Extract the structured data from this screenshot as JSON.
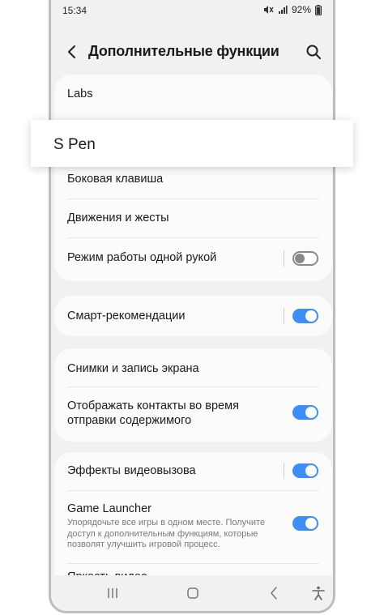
{
  "status": {
    "time": "15:34",
    "battery": "92%"
  },
  "header": {
    "title": "Дополнительные функции"
  },
  "items": {
    "labs": "Labs",
    "side_key": "Боковая клавиша",
    "motions": "Движения и жесты",
    "one_hand": "Режим работы одной рукой",
    "smart": "Смарт-рекомендации",
    "screenshots": "Снимки и запись экрана",
    "contacts_line1": "Отображать контакты во время",
    "contacts_line2": "отправки содержимого",
    "video_effects": "Эффекты видеовызова",
    "game_launcher": "Game Launcher",
    "game_desc1": "Упорядочьте все игры в одном месте. Получите",
    "game_desc2": "доступ к дополнительным функциям, которые",
    "game_desc3": "позволят улучшить игровой процесс.",
    "video_brightness": "Яркость видео"
  },
  "toggles": {
    "one_hand": false,
    "smart": true,
    "contacts": true,
    "video_effects": true,
    "game_launcher": true
  },
  "popout": {
    "label": "S Pen"
  },
  "colors": {
    "accent": "#3e8ef7",
    "background": "#f1f1f1",
    "card": "#fbfbfb"
  }
}
